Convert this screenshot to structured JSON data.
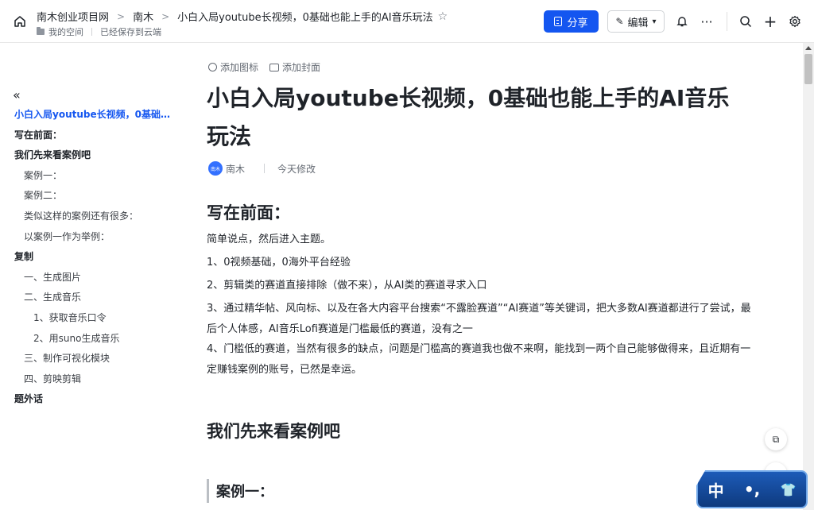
{
  "header": {
    "breadcrumb": [
      "南木创业项目网",
      "南木",
      "小白入局youtube长视频，0基础也能上手的AI音乐玩法"
    ],
    "space_label": "我的空间",
    "save_status": "已经保存到云端",
    "share_label": "分享",
    "edit_label": "编辑"
  },
  "outline": {
    "items": [
      {
        "text": "小白入局youtube长视频，0基础也能上手的AI音乐玩法",
        "level": 1,
        "active": true
      },
      {
        "text": "写在前面：",
        "level": 1
      },
      {
        "text": "我们先来看案例吧",
        "level": 1
      },
      {
        "text": "案例一：",
        "level": 2
      },
      {
        "text": "案例二：",
        "level": 2
      },
      {
        "text": "类似这样的案例还有很多：",
        "level": 2
      },
      {
        "text": "以案例一作为举例：",
        "level": 2
      },
      {
        "text": "复制",
        "level": 1
      },
      {
        "text": "一、生成图片",
        "level": 2
      },
      {
        "text": "二、生成音乐",
        "level": 2
      },
      {
        "text": "1、获取音乐口令",
        "level": 3
      },
      {
        "text": "2、用suno生成音乐",
        "level": 3
      },
      {
        "text": "三、制作可视化模块",
        "level": 2
      },
      {
        "text": "四、剪映剪辑",
        "level": 2
      },
      {
        "text": "题外话",
        "level": 1
      }
    ]
  },
  "doc": {
    "add_icon_label": "添加图标",
    "add_cover_label": "添加封面",
    "title_line1": "小白入局youtube长视频，0基础也能上手的AI音乐",
    "title_line2": "玩法",
    "author": "南木",
    "avatar_text": "南木",
    "modified": "今天修改",
    "section1_heading": "写在前面：",
    "paragraphs": [
      "简单说点，然后进入主题。",
      "1、0视频基础，0海外平台经验",
      "2、剪辑类的赛道直接排除（做不来），从AI类的赛道寻求入口",
      "3、通过精华帖、风向标、以及在各大内容平台搜索“不露脸赛道”“AI赛道”等关键词，把大多数AI赛道都进行了尝试，最后个人体感，AI音乐Lofi赛道是门槛最低的赛道，没有之一",
      "4、门槛低的赛道，当然有很多的缺点，问题是门槛高的赛道我也做不来啊，能找到一两个自己能够做得来，且近期有一定赚钱案例的账号，已然是幸运。"
    ],
    "section2_heading": "我们先来看案例吧",
    "section3_heading": "案例一："
  },
  "ime": {
    "chars": [
      "中",
      "•,",
      "👕"
    ]
  }
}
